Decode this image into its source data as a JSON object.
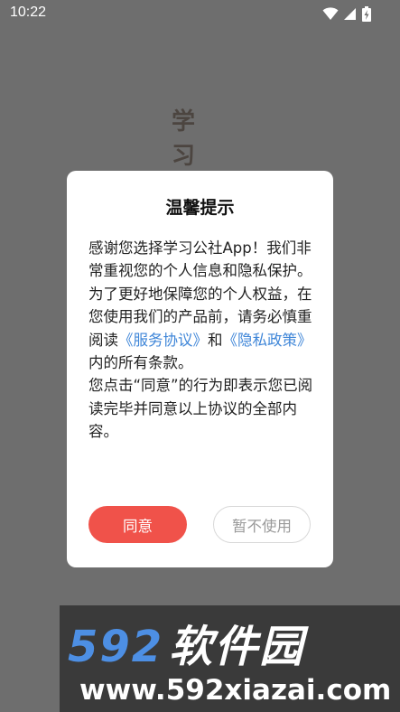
{
  "status_bar": {
    "time": "10:22",
    "icons": [
      "wifi-icon",
      "cellular-signal-icon",
      "battery-charging-icon"
    ]
  },
  "background": {
    "title_chars": [
      "学",
      "习"
    ]
  },
  "dialog": {
    "title": "温馨提示",
    "body": {
      "intro": "感谢您选择学习公社App！我们非常重视您的个人信息和隐私保护。为了更好地保障您的个人权益，在您使用我们的产品前，请务必慎重阅读",
      "service_link": "《服务协议》",
      "and": "和",
      "privacy_link": "《隐私政策》",
      "suffix": "内的所有条款。",
      "consent": "您点击“同意”的行为即表示您已阅读完毕并同意以上协议的全部内容。"
    },
    "agree_label": "同意",
    "decline_label": "暂不使用"
  },
  "watermark": {
    "logo_number": "592",
    "logo_text": "软件园",
    "url": "www.592xiazai.com"
  },
  "colors": {
    "overlay": "#6e6e6e",
    "agree": "#f0524a",
    "link": "#3f86d8",
    "watermark_blue": "#4d8fe4"
  }
}
